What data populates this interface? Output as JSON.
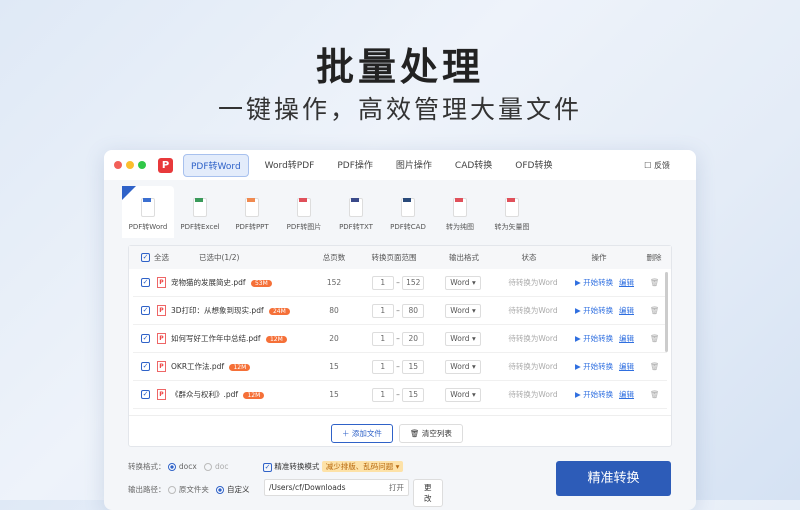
{
  "hero": {
    "title": "批量处理",
    "subtitle": "一键操作，高效管理大量文件"
  },
  "tabs": [
    "PDF转Word",
    "Word转PDF",
    "PDF操作",
    "图片操作",
    "CAD转换",
    "OFD转换"
  ],
  "feedback": "反馈",
  "logo": "P",
  "tools": [
    {
      "label": "PDF转Word",
      "color": "#3b6fd0"
    },
    {
      "label": "PDF转Excel",
      "color": "#3a9a5a"
    },
    {
      "label": "PDF转PPT",
      "color": "#f08a50"
    },
    {
      "label": "PDF转图片",
      "color": "#e0505a"
    },
    {
      "label": "PDF转TXT",
      "color": "#3a4a8a"
    },
    {
      "label": "PDF转CAD",
      "color": "#2a4a7a"
    },
    {
      "label": "转为纯图",
      "color": "#e0505a"
    },
    {
      "label": "转为矢量图",
      "color": "#e0505a"
    }
  ],
  "table": {
    "select_all": "全选",
    "selected": "已选中(1/2)",
    "headers": [
      "总页数",
      "转换页面范围",
      "输出格式",
      "状态",
      "操作",
      "删除"
    ],
    "rows": [
      {
        "name": "宠物猫的发展简史.pdf",
        "size": "53M",
        "pages": "152",
        "from": "1",
        "to": "152",
        "format": "Word",
        "status": "待转换为Word"
      },
      {
        "name": "3D打印：从想象到现实.pdf",
        "size": "24M",
        "pages": "80",
        "from": "1",
        "to": "80",
        "format": "Word",
        "status": "待转换为Word"
      },
      {
        "name": "如何写好工作年中总结.pdf",
        "size": "12M",
        "pages": "20",
        "from": "1",
        "to": "20",
        "format": "Word",
        "status": "待转换为Word"
      },
      {
        "name": "OKR工作法.pdf",
        "size": "12M",
        "pages": "15",
        "from": "1",
        "to": "15",
        "format": "Word",
        "status": "待转换为Word"
      },
      {
        "name": "《群众与权利》.pdf",
        "size": "12M",
        "pages": "15",
        "from": "1",
        "to": "15",
        "format": "Word",
        "status": "待转换为Word"
      }
    ],
    "start": "开始转换",
    "edit": "编辑",
    "add_file": "添加文件",
    "clear_list": "清空列表"
  },
  "footer": {
    "format_label": "转换格式：",
    "docx": "docx",
    "doc": "doc",
    "precise_mode": "精准转换模式",
    "precise_tip": "减少排版、乱码问题",
    "path_label": "输出路径：",
    "source_folder": "原文件夹",
    "custom": "自定义",
    "path": "/Users/cf/Downloads",
    "open": "打开",
    "change": "更改",
    "convert": "精准转换"
  }
}
